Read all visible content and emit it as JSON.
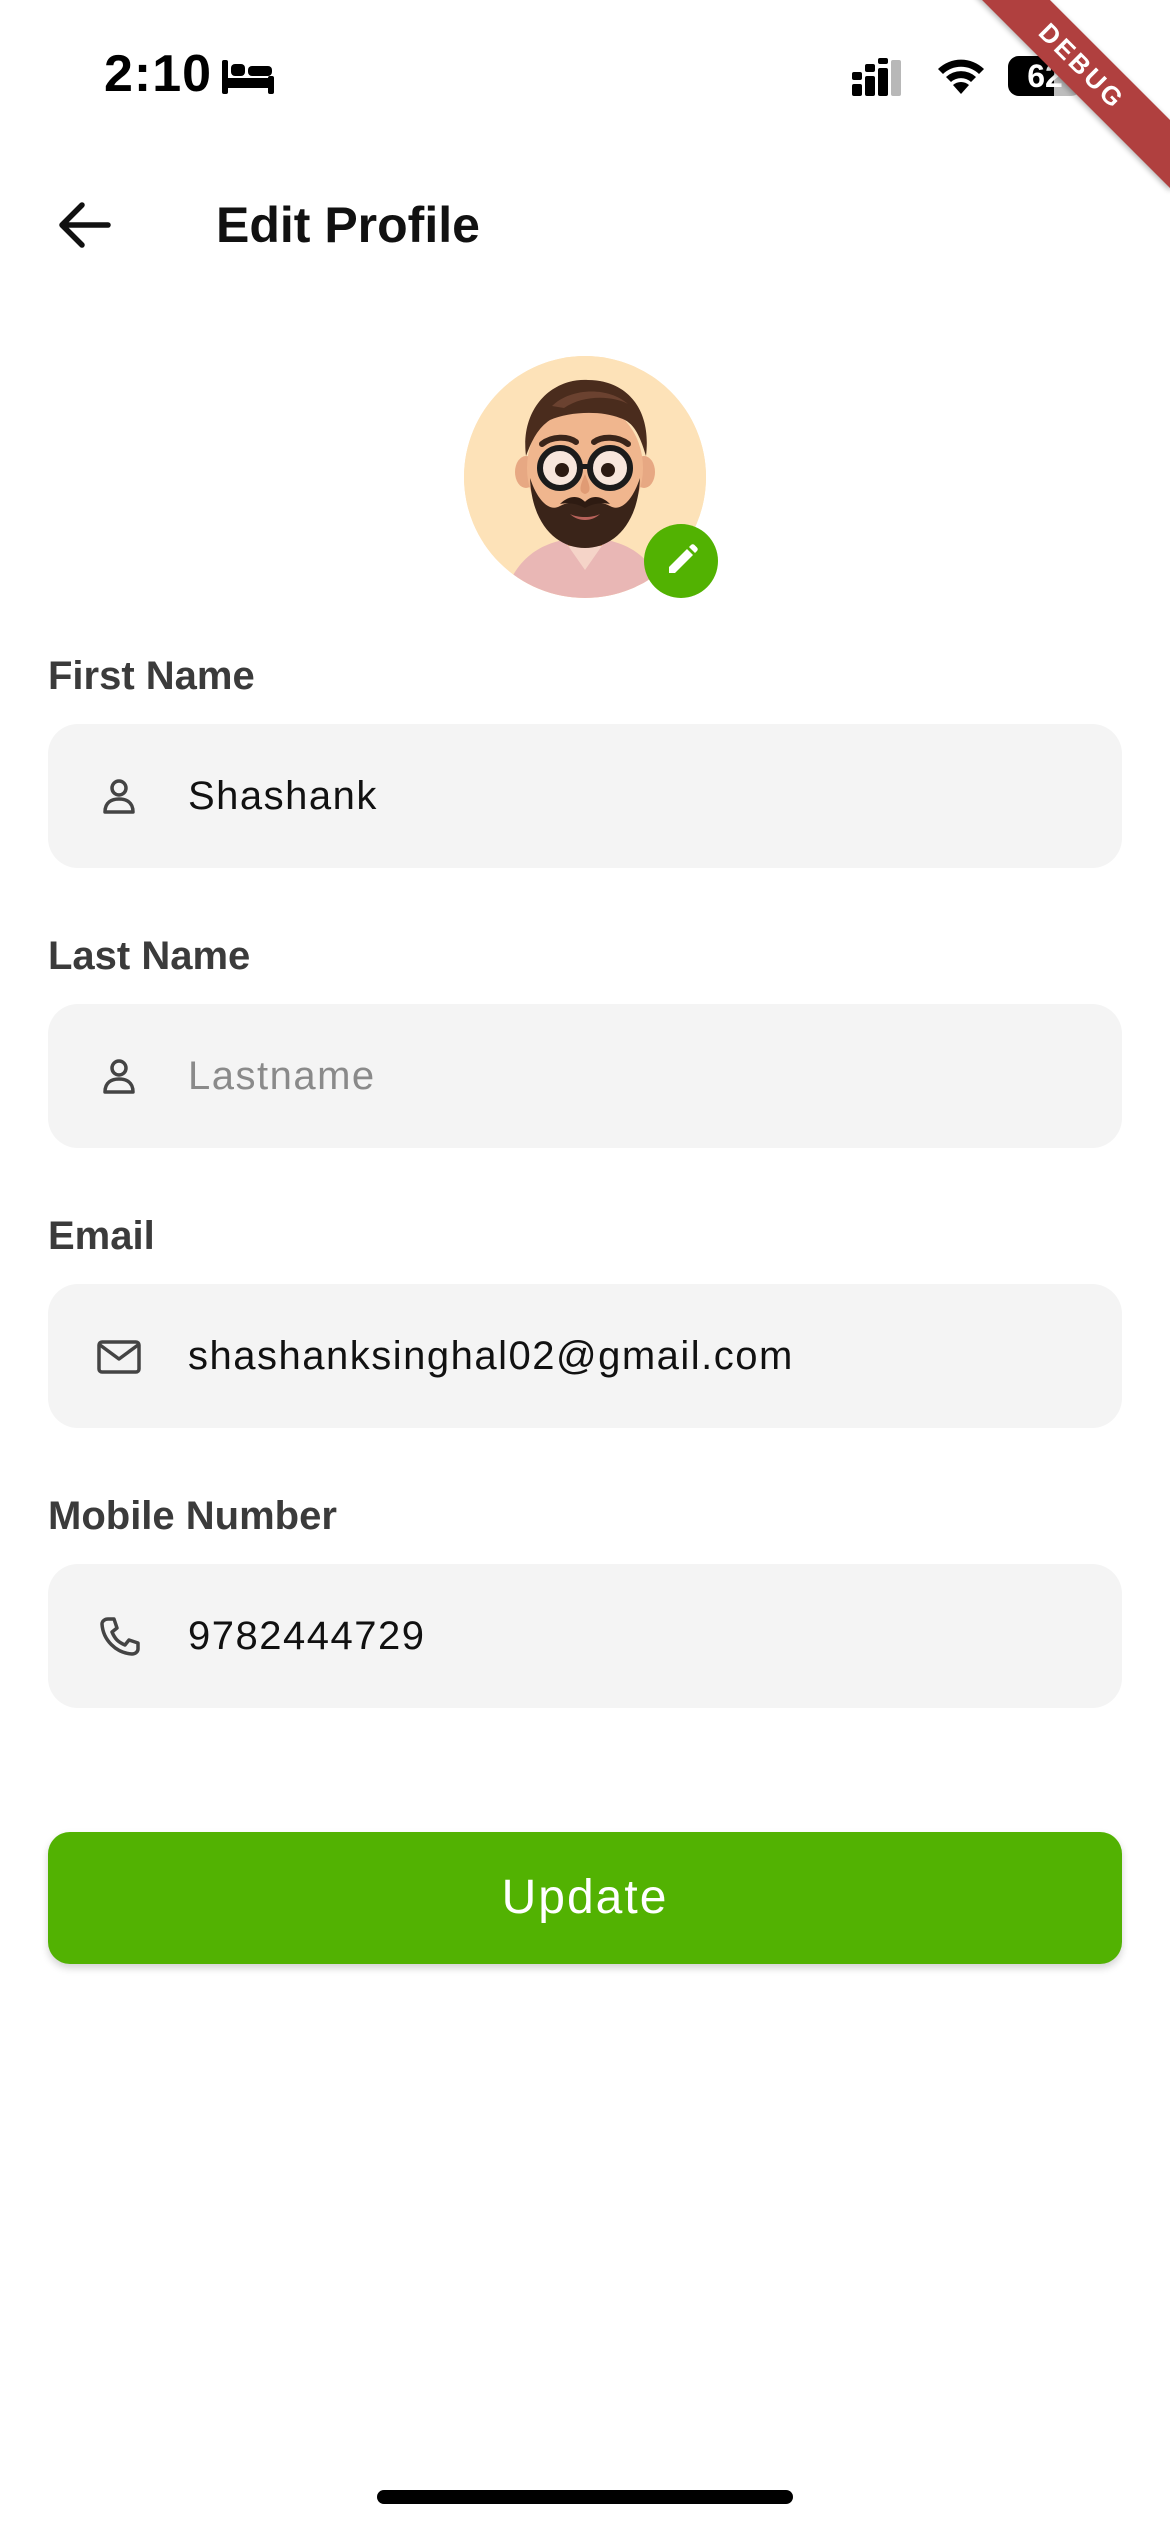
{
  "status_bar": {
    "time": "2:10",
    "battery_level": "62",
    "battery_percent": 62,
    "sleep_icon": "bed-icon",
    "signal_icon": "cellular-signal-icon",
    "wifi_icon": "wifi-icon"
  },
  "debug_banner": "DEBUG",
  "app_bar": {
    "title": "Edit Profile",
    "back_icon": "arrow-left-icon"
  },
  "avatar": {
    "edit_icon": "pencil-icon"
  },
  "form": {
    "first_name": {
      "label": "First Name",
      "value": "Shashank",
      "icon": "person-icon"
    },
    "last_name": {
      "label": "Last Name",
      "value": "",
      "placeholder": "Lastname",
      "icon": "person-icon"
    },
    "email": {
      "label": "Email",
      "value": "shashanksinghal02@gmail.com",
      "icon": "mail-icon"
    },
    "mobile": {
      "label": "Mobile Number",
      "value": "9782444729",
      "icon": "phone-icon"
    }
  },
  "update_button": {
    "label": "Update"
  },
  "colors": {
    "accent": "#52b202",
    "field_background": "#f4f4f4",
    "debug_ribbon": "#b0403f"
  }
}
